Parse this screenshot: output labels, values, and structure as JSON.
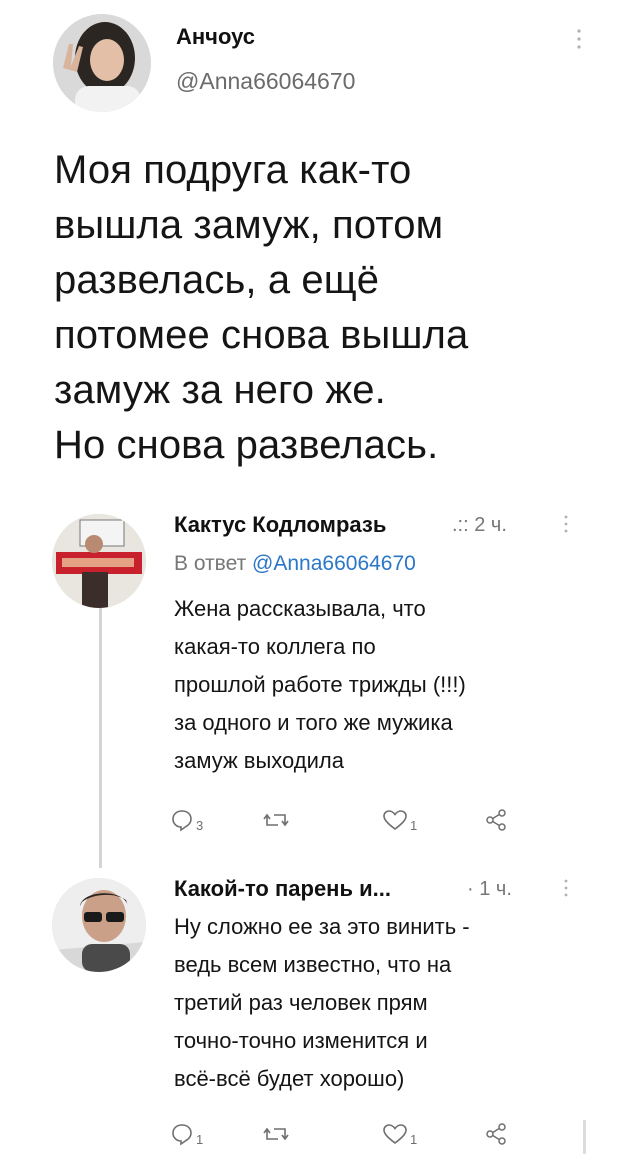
{
  "tweet": {
    "author_name": "Анчоус",
    "author_handle": "@Anna66064670",
    "text_lines": [
      "Моя подруга как-то",
      "вышла замуж, потом",
      "развелась, а ещё",
      "потомее снова вышла",
      "замуж за него же.",
      "Но снова развелась."
    ]
  },
  "replies": [
    {
      "author_name": "Кактус Кодломразь",
      "meta": ".:: 2 ч.",
      "reply_to_label": "В ответ",
      "reply_to_handle": "@Anna66064670",
      "text_lines": [
        "Жена рассказывала, что",
        "какая-то коллега по",
        "прошлой работе трижды (!!!)",
        "за одного и того же мужика",
        "замуж выходила"
      ],
      "actions": {
        "replies": "3",
        "retweets": "",
        "likes": "1"
      }
    },
    {
      "author_name": "Какой-то парень и...",
      "meta": "· 1 ч.",
      "text_lines": [
        "Ну сложно ее за это винить -",
        "ведь всем известно, что на",
        "третий раз человек прям",
        "точно-точно изменится и",
        "всё-всё будет хорошо)"
      ],
      "actions": {
        "replies": "1",
        "retweets": "",
        "likes": "1"
      }
    }
  ],
  "icons": {
    "more": "more-vertical-icon",
    "reply": "comment-icon",
    "retweet": "retweet-icon",
    "like": "heart-icon",
    "share": "share-icon"
  },
  "colors": {
    "mention": "#2a77c8",
    "muted": "#6b6b6b"
  }
}
